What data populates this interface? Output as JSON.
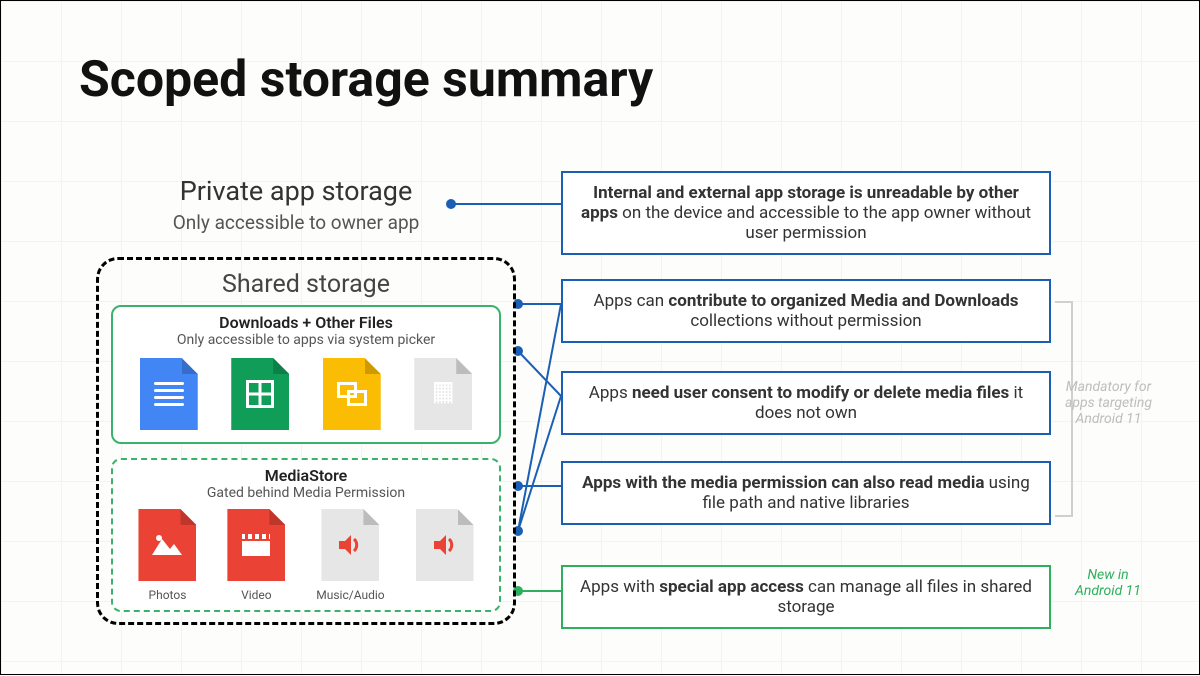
{
  "title": "Scoped storage summary",
  "private": {
    "heading": "Private app storage",
    "sub": "Only accessible to owner app"
  },
  "shared": {
    "heading": "Shared storage",
    "downloads": {
      "heading": "Downloads + Other Files",
      "sub": "Only accessible to apps via system picker",
      "icons": [
        "doc",
        "sheet",
        "slides",
        "pdf"
      ]
    },
    "mediastore": {
      "heading": "MediaStore",
      "sub": "Gated behind Media Permission",
      "items": [
        {
          "label": "Photos"
        },
        {
          "label": "Video"
        },
        {
          "label": "Music/Audio",
          "spans_two": true
        }
      ]
    }
  },
  "descriptions": {
    "d1_pre": "Internal and external app storage is unreadable by other apps",
    "d1_post": " on the device and accessible to the app owner without user permission",
    "d2_pre": "Apps can ",
    "d2_bold": "contribute to organized Media and Downloads",
    "d2_post": " collections without permission",
    "d3_pre": "Apps ",
    "d3_bold": "need user consent to modify or delete media files",
    "d3_post": " it does not own",
    "d4_bold": "Apps with the media permission can also read media",
    "d4_post": " using file path and native libraries",
    "d5_pre": "Apps with ",
    "d5_bold": "special app access",
    "d5_post": " can manage all files in shared storage"
  },
  "annotations": {
    "mandatory": "Mandatory for apps targeting Android 11",
    "new": "New in Android 11"
  }
}
